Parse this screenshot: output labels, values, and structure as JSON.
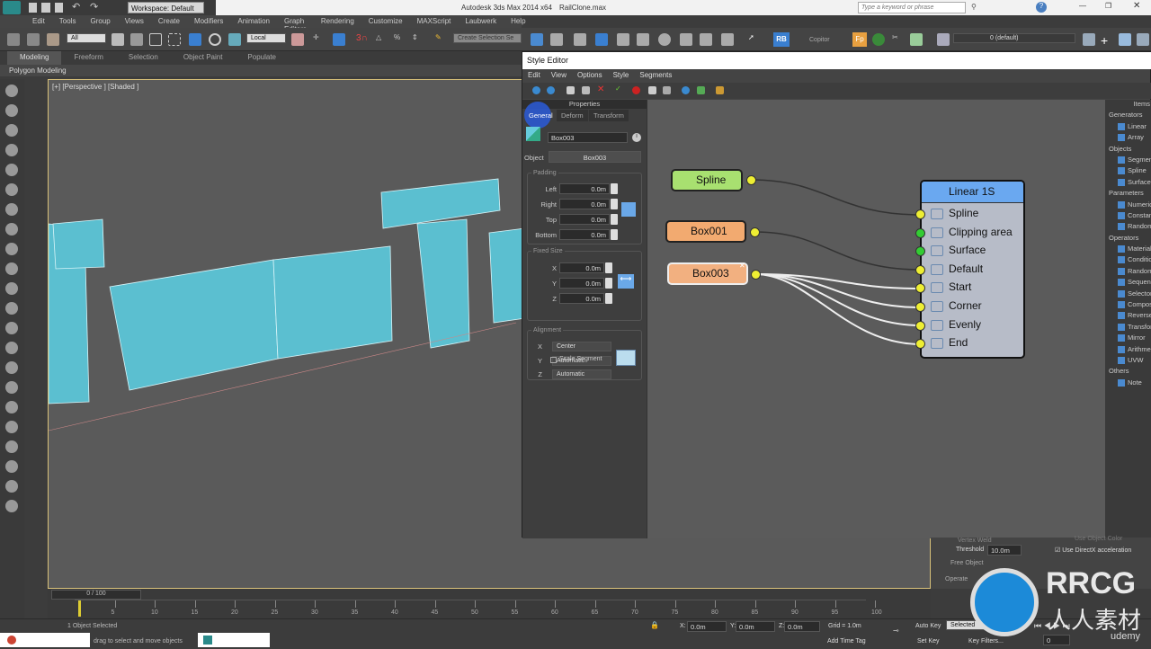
{
  "app": {
    "title": "Autodesk 3ds Max  2014 x64",
    "file": "RailClone.max",
    "workspace": "Workspace: Default",
    "search_placeholder": "Type a keyword or phrase"
  },
  "menu": [
    "Edit",
    "Tools",
    "Group",
    "Views",
    "Create",
    "Modifiers",
    "Animation",
    "Graph Editors",
    "Rendering",
    "Customize",
    "MAXScript",
    "Laubwerk",
    "Help"
  ],
  "toolbar": {
    "filter": "All",
    "coord": "Local",
    "selection_set": "Create Selection Se",
    "copitor": "Copitor",
    "layer": "0 (default)",
    "rb": "RB",
    "fp": "Fp"
  },
  "ribbon": {
    "tabs": [
      "Modeling",
      "Freeform",
      "Selection",
      "Object Paint",
      "Populate"
    ],
    "active": "Modeling",
    "panel": "Polygon Modeling"
  },
  "viewport": {
    "label": "[+] [Perspective ] [Shaded ]",
    "object_color": "#5bbfd0"
  },
  "style_editor": {
    "title": "Style Editor",
    "menu": [
      "Edit",
      "View",
      "Options",
      "Style",
      "Segments"
    ],
    "properties": {
      "header": "Properties",
      "tabs": [
        "General",
        "Deform",
        "Transform"
      ],
      "active_tab": "General",
      "name": "Box003",
      "object_label": "Object",
      "object_value": "Box003",
      "padding": {
        "title": "Padding",
        "rows": [
          {
            "label": "Left",
            "value": "0.0m"
          },
          {
            "label": "Right",
            "value": "0.0m"
          },
          {
            "label": "Top",
            "value": "0.0m"
          },
          {
            "label": "Bottom",
            "value": "0.0m"
          }
        ]
      },
      "fixed_size": {
        "title": "Fixed Size",
        "rows": [
          {
            "label": "X",
            "value": "0.0m"
          },
          {
            "label": "Y",
            "value": "0.0m"
          },
          {
            "label": "Z",
            "value": "0.0m"
          }
        ],
        "scale_segment": "Scale Segment",
        "scale_segment_checked": false
      },
      "alignment": {
        "title": "Alignment",
        "rows": [
          {
            "label": "X",
            "value": "Center"
          },
          {
            "label": "Y",
            "value": "Automatic"
          },
          {
            "label": "Z",
            "value": "Automatic"
          }
        ]
      }
    },
    "graph": {
      "nodes": {
        "spline": "Spline",
        "box001": "Box001",
        "box003": "Box003"
      },
      "generator": {
        "title": "Linear 1S",
        "inputs": [
          "Spline",
          "Clipping area",
          "Surface",
          "Default",
          "Start",
          "Corner",
          "Evenly",
          "End"
        ]
      }
    },
    "items": {
      "header": "Items",
      "groups": [
        {
          "title": "Generators",
          "items": [
            "Linear",
            "Array"
          ]
        },
        {
          "title": "Objects",
          "items": [
            "Segment",
            "Spline",
            "Surface"
          ]
        },
        {
          "title": "Parameters",
          "items": [
            "Numeric",
            "Constant",
            "Random"
          ]
        },
        {
          "title": "Operators",
          "items": [
            "Material",
            "Conditional",
            "Randomize",
            "Sequence",
            "Selector",
            "Compose",
            "Reverse",
            "Transform",
            "Mirror",
            "Arithmetic",
            "UVW"
          ]
        },
        {
          "title": "Others",
          "items": [
            "Note"
          ]
        }
      ]
    }
  },
  "command_panel": {
    "vertex_weld": "Vertex Weld",
    "threshold_label": "Threshold",
    "threshold": "10.0m",
    "free_object": "Free Object",
    "operate": "Operate",
    "use_directx": "Use DirectX acceleration",
    "use_object_color": "Use Object Color"
  },
  "timeline": {
    "frame": "0 / 100",
    "ticks": [
      "5",
      "10",
      "15",
      "20",
      "25",
      "30",
      "35",
      "40",
      "45",
      "50",
      "55",
      "60",
      "65",
      "70",
      "75",
      "80",
      "85",
      "90",
      "95",
      "100"
    ]
  },
  "status": {
    "selected": "1 Object Selected",
    "prompt": "drag to select and move objects",
    "x": "0.0m",
    "y": "0.0m",
    "z": "0.0m",
    "grid": "Grid = 1.0m",
    "add_time_tag": "Add Time Tag",
    "auto_key": "Auto Key",
    "key_mode": "Selected",
    "set_key": "Set Key",
    "key_filters": "Key Filters...",
    "frame_field": "0"
  },
  "watermark": {
    "brand": "RRCG",
    "cn": "人人素材",
    "udemy": "udemy"
  }
}
